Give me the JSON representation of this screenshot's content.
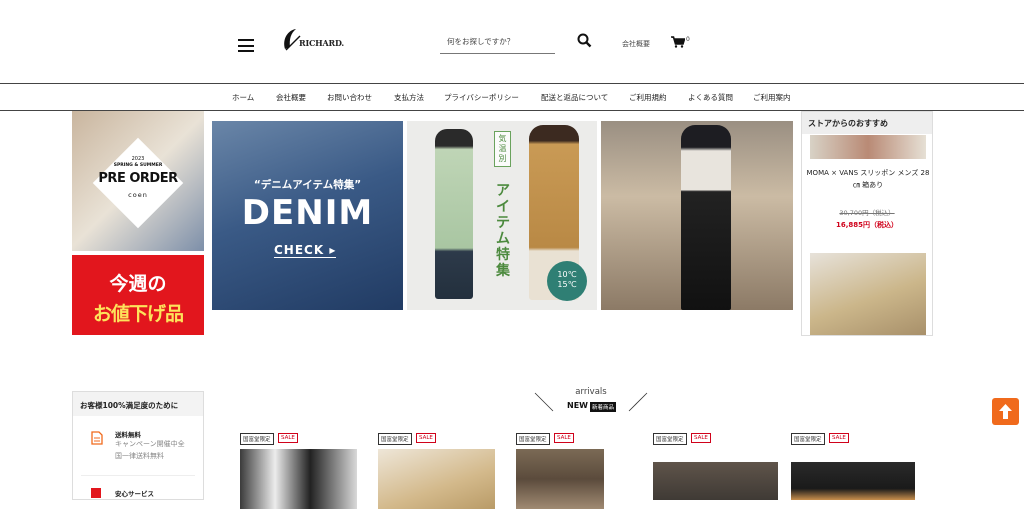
{
  "header": {
    "brand": "RICHARD.",
    "search_placeholder": "何をお探しですか？",
    "company_link": "会社概要",
    "cart_count": "0"
  },
  "nav": [
    "ホーム",
    "会社概要",
    "お問い合わせ",
    "支払方法",
    "プライバシーポリシー",
    "配送と返品について",
    "ご利用規約",
    "よくある質問",
    "ご利用案内"
  ],
  "banners": {
    "preorder": {
      "year": "2023",
      "season": "SPRING & SUMMER",
      "title": "PRE ORDER",
      "brand": "coen"
    },
    "weekly_sale": {
      "line1": "今週の",
      "line2": "お値下げ品"
    },
    "denim": {
      "subtitle": "“デニムアイテム特集”",
      "title": "DENIM",
      "cta": "CHECK ▸"
    },
    "temperature": {
      "label": "気温別",
      "title": "アイテム特集",
      "badge_line1": "10℃",
      "badge_line2": "15℃"
    }
  },
  "recommend": {
    "title": "ストアからのおすすめ",
    "product_name": "MOMA × VANS スリッポン メンズ 28㎝ 箱あり",
    "old_price": "30,700円（税込）",
    "price": "16,885円（税込）"
  },
  "info": {
    "heading": "お客様100%満足度のために",
    "items": [
      {
        "title": "送料無料",
        "desc1": "キャンペーン開催中全",
        "desc2": "国一律送料無料"
      },
      {
        "title": "安心サービス"
      }
    ]
  },
  "arrivals": {
    "subtitle": "arrivals",
    "title": "NEW",
    "badge": "新着商品",
    "tag_limited": "国富堂限定",
    "tag_sale": "SALE"
  },
  "colors": {
    "accent_orange": "#f06a1c",
    "sale_red": "#e2161d",
    "price_red": "#d0021b"
  }
}
